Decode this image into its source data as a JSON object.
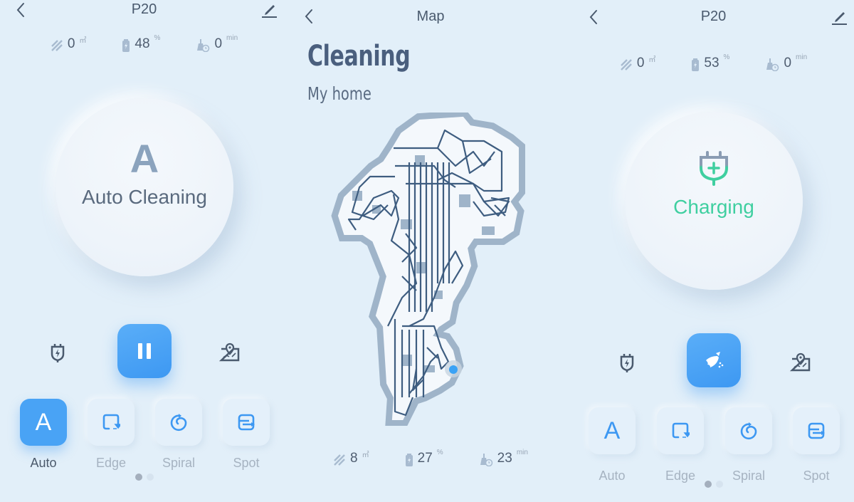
{
  "colors": {
    "background": "#e2eff9",
    "accent": "#3d98f2",
    "text": "#4a5a6e",
    "charging": "#3fcfa0",
    "map_wall": "#9fb4c9",
    "map_path": "#3e5d80",
    "robot": "#3aa2f5"
  },
  "screen_left": {
    "header": {
      "title": "P20",
      "back_icon": "chevron-left-icon",
      "edit_icon": "pencil-icon"
    },
    "stats": [
      {
        "icon": "area-icon",
        "value": "0",
        "unit": "㎡"
      },
      {
        "icon": "battery-icon",
        "value": "48",
        "unit": "%"
      },
      {
        "icon": "clean-time-icon",
        "value": "0",
        "unit": "min"
      }
    ],
    "status": {
      "letter": "A",
      "label": "Auto Cleaning"
    },
    "controls": {
      "left_icon": "dock-charge-icon",
      "main_icon": "pause-icon",
      "right_icon": "map-pin-icon"
    },
    "modes": [
      {
        "label": "Auto",
        "glyph": "A",
        "active": true
      },
      {
        "label": "Edge",
        "icon": "edge-icon",
        "active": false
      },
      {
        "label": "Spiral",
        "icon": "spiral-icon",
        "active": false
      },
      {
        "label": "Spot",
        "icon": "spot-icon",
        "active": false
      }
    ],
    "page": {
      "current": 1,
      "total": 2
    }
  },
  "screen_middle": {
    "header": {
      "title": "Map",
      "back_icon": "chevron-left-icon"
    },
    "heading": "Cleaning",
    "subheading": "My home",
    "stats": [
      {
        "icon": "area-icon",
        "value": "8",
        "unit": "㎡"
      },
      {
        "icon": "battery-icon",
        "value": "27",
        "unit": "%"
      },
      {
        "icon": "clean-time-icon",
        "value": "23",
        "unit": "min"
      }
    ]
  },
  "screen_right": {
    "header": {
      "title": "P20",
      "back_icon": "chevron-left-icon",
      "edit_icon": "pencil-icon"
    },
    "stats": [
      {
        "icon": "area-icon",
        "value": "0",
        "unit": "㎡"
      },
      {
        "icon": "battery-icon",
        "value": "53",
        "unit": "%"
      },
      {
        "icon": "clean-time-icon",
        "value": "0",
        "unit": "min"
      }
    ],
    "status": {
      "icon": "charging-plug-icon",
      "label": "Charging"
    },
    "controls": {
      "left_icon": "dock-charge-icon",
      "main_icon": "broom-icon",
      "right_icon": "map-pin-icon"
    },
    "modes": [
      {
        "label": "Auto",
        "glyph": "A",
        "active": false
      },
      {
        "label": "Edge",
        "icon": "edge-icon",
        "active": false
      },
      {
        "label": "Spiral",
        "icon": "spiral-icon",
        "active": false
      },
      {
        "label": "Spot",
        "icon": "spot-icon",
        "active": false
      }
    ],
    "page": {
      "current": 1,
      "total": 2
    }
  }
}
